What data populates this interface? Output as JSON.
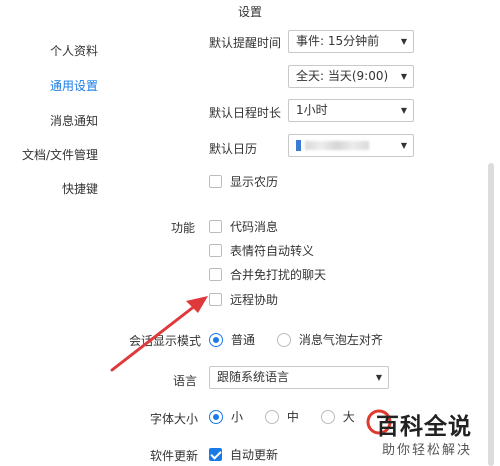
{
  "window": {
    "title": "设置"
  },
  "sidebar": {
    "items": [
      {
        "label": "个人资料",
        "active": false
      },
      {
        "label": "通用设置",
        "active": true
      },
      {
        "label": "消息通知",
        "active": false
      },
      {
        "label": "文档/文件管理",
        "active": false
      },
      {
        "label": "快捷键",
        "active": false
      }
    ]
  },
  "settings": {
    "reminder": {
      "label": "默认提醒时间",
      "event_value": "事件: 15分钟前",
      "allday_value": "全天: 当天(9:00)"
    },
    "duration": {
      "label": "默认日程时长",
      "value": "1小时"
    },
    "calendar": {
      "label": "默认日历"
    },
    "lunar": {
      "label": "显示农历",
      "checked": false
    },
    "features": {
      "label": "功能",
      "options": [
        {
          "label": "代码消息",
          "checked": false
        },
        {
          "label": "表情符自动转义",
          "checked": false
        },
        {
          "label": "合并免打扰的聊天",
          "checked": false
        },
        {
          "label": "远程协助",
          "checked": false
        }
      ]
    },
    "display_mode": {
      "label": "会话显示模式",
      "options": [
        {
          "label": "普通",
          "checked": true
        },
        {
          "label": "消息气泡左对齐",
          "checked": false
        }
      ]
    },
    "language": {
      "label": "语言",
      "value": "跟随系统语言"
    },
    "font_size": {
      "label": "字体大小",
      "options": [
        {
          "label": "小",
          "checked": true
        },
        {
          "label": "中",
          "checked": false
        },
        {
          "label": "大",
          "checked": false
        }
      ]
    },
    "update": {
      "label": "软件更新",
      "option": "自动更新",
      "checked": true
    }
  },
  "watermark": {
    "main": "百科全说",
    "sub": "助你轻松解决"
  },
  "colors": {
    "accent": "#1a7be8",
    "arrow": "#e0393b",
    "watermark_red": "#e03a2e"
  }
}
